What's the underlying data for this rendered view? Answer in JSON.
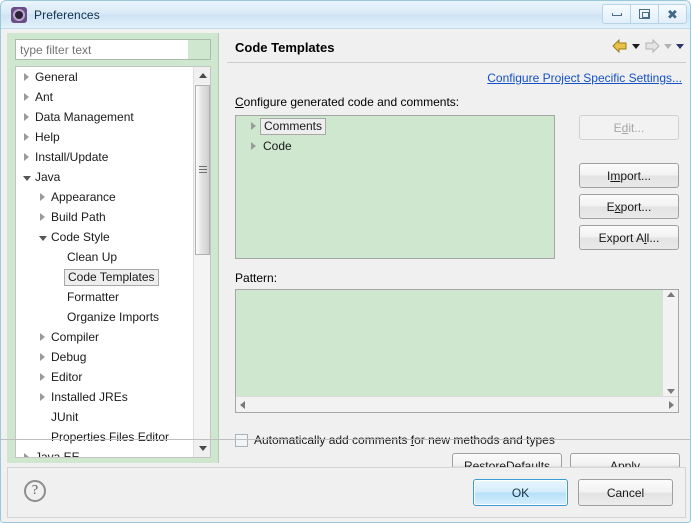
{
  "window": {
    "title": "Preferences",
    "icon": "preferences-gear-icon",
    "controls": {
      "minimize": "Minimize",
      "maximize": "Restore",
      "close": "Close"
    }
  },
  "sidebar": {
    "filter": {
      "value": "",
      "placeholder": "type filter text"
    },
    "tree": [
      {
        "label": "General",
        "depth": 0,
        "state": "collapsed",
        "selected": false
      },
      {
        "label": "Ant",
        "depth": 0,
        "state": "collapsed",
        "selected": false
      },
      {
        "label": "Data Management",
        "depth": 0,
        "state": "collapsed",
        "selected": false
      },
      {
        "label": "Help",
        "depth": 0,
        "state": "collapsed",
        "selected": false
      },
      {
        "label": "Install/Update",
        "depth": 0,
        "state": "collapsed",
        "selected": false
      },
      {
        "label": "Java",
        "depth": 0,
        "state": "expanded",
        "selected": false
      },
      {
        "label": "Appearance",
        "depth": 1,
        "state": "collapsed",
        "selected": false
      },
      {
        "label": "Build Path",
        "depth": 1,
        "state": "collapsed",
        "selected": false
      },
      {
        "label": "Code Style",
        "depth": 1,
        "state": "expanded",
        "selected": false
      },
      {
        "label": "Clean Up",
        "depth": 2,
        "state": "leaf",
        "selected": false
      },
      {
        "label": "Code Templates",
        "depth": 2,
        "state": "leaf",
        "selected": true
      },
      {
        "label": "Formatter",
        "depth": 2,
        "state": "leaf",
        "selected": false
      },
      {
        "label": "Organize Imports",
        "depth": 2,
        "state": "leaf",
        "selected": false
      },
      {
        "label": "Compiler",
        "depth": 1,
        "state": "collapsed",
        "selected": false
      },
      {
        "label": "Debug",
        "depth": 1,
        "state": "collapsed",
        "selected": false
      },
      {
        "label": "Editor",
        "depth": 1,
        "state": "collapsed",
        "selected": false
      },
      {
        "label": "Installed JREs",
        "depth": 1,
        "state": "collapsed",
        "selected": false
      },
      {
        "label": "JUnit",
        "depth": 1,
        "state": "leaf",
        "selected": false
      },
      {
        "label": "Properties Files Editor",
        "depth": 1,
        "state": "leaf",
        "selected": false
      },
      {
        "label": "Java EE",
        "depth": 0,
        "state": "collapsed",
        "selected": false
      }
    ]
  },
  "page": {
    "title": "Code Templates",
    "nav": {
      "back_icon": "back-arrow-icon",
      "back_menu_icon": "chevron-down-icon",
      "forward_icon": "forward-arrow-icon",
      "forward_menu_icon": "chevron-down-icon",
      "history_menu_icon": "chevron-down-icon"
    },
    "project_link": "Configure Project Specific Settings...",
    "section_label_prefix": "C",
    "section_label_rest": "onfigure generated code and comments:",
    "templates": [
      {
        "label": "Comments",
        "state": "collapsed",
        "selected": true
      },
      {
        "label": "Code",
        "state": "collapsed",
        "selected": false
      }
    ],
    "buttons": {
      "edit": {
        "pre": "E",
        "mn": "d",
        "post": "it...",
        "enabled": false
      },
      "import": {
        "pre": "I",
        "mn": "m",
        "post": "port...",
        "enabled": true
      },
      "export": {
        "pre": "E",
        "mn": "x",
        "post": "port...",
        "enabled": true
      },
      "export_all": {
        "pre": "Export A",
        "mn": "l",
        "post": "l...",
        "enabled": true
      }
    },
    "pattern": {
      "label_pre": "Pa",
      "label_mn": "t",
      "label_post": "tern:",
      "value": ""
    },
    "auto_comments": {
      "checked": false,
      "pre": "Automatically add comments ",
      "mn": "f",
      "post": "or new methods and types"
    },
    "restore_defaults": {
      "pre": "Restore ",
      "mn": "D",
      "post": "efaults"
    },
    "apply": {
      "pre": "",
      "mn": "A",
      "post": "pply"
    }
  },
  "footer": {
    "help_icon": "help-question-icon",
    "ok": "OK",
    "cancel": "Cancel"
  }
}
